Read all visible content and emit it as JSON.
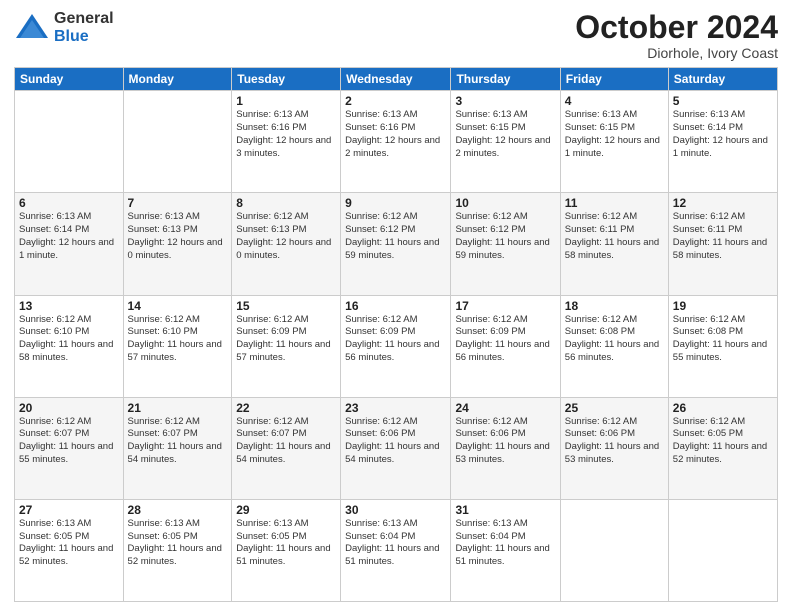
{
  "logo": {
    "general": "General",
    "blue": "Blue"
  },
  "header": {
    "month": "October 2024",
    "location": "Diorhole, Ivory Coast"
  },
  "days_of_week": [
    "Sunday",
    "Monday",
    "Tuesday",
    "Wednesday",
    "Thursday",
    "Friday",
    "Saturday"
  ],
  "weeks": [
    [
      {
        "day": "",
        "info": ""
      },
      {
        "day": "",
        "info": ""
      },
      {
        "day": "1",
        "info": "Sunrise: 6:13 AM\nSunset: 6:16 PM\nDaylight: 12 hours and 3 minutes."
      },
      {
        "day": "2",
        "info": "Sunrise: 6:13 AM\nSunset: 6:16 PM\nDaylight: 12 hours and 2 minutes."
      },
      {
        "day": "3",
        "info": "Sunrise: 6:13 AM\nSunset: 6:15 PM\nDaylight: 12 hours and 2 minutes."
      },
      {
        "day": "4",
        "info": "Sunrise: 6:13 AM\nSunset: 6:15 PM\nDaylight: 12 hours and 1 minute."
      },
      {
        "day": "5",
        "info": "Sunrise: 6:13 AM\nSunset: 6:14 PM\nDaylight: 12 hours and 1 minute."
      }
    ],
    [
      {
        "day": "6",
        "info": "Sunrise: 6:13 AM\nSunset: 6:14 PM\nDaylight: 12 hours and 1 minute."
      },
      {
        "day": "7",
        "info": "Sunrise: 6:13 AM\nSunset: 6:13 PM\nDaylight: 12 hours and 0 minutes."
      },
      {
        "day": "8",
        "info": "Sunrise: 6:12 AM\nSunset: 6:13 PM\nDaylight: 12 hours and 0 minutes."
      },
      {
        "day": "9",
        "info": "Sunrise: 6:12 AM\nSunset: 6:12 PM\nDaylight: 11 hours and 59 minutes."
      },
      {
        "day": "10",
        "info": "Sunrise: 6:12 AM\nSunset: 6:12 PM\nDaylight: 11 hours and 59 minutes."
      },
      {
        "day": "11",
        "info": "Sunrise: 6:12 AM\nSunset: 6:11 PM\nDaylight: 11 hours and 58 minutes."
      },
      {
        "day": "12",
        "info": "Sunrise: 6:12 AM\nSunset: 6:11 PM\nDaylight: 11 hours and 58 minutes."
      }
    ],
    [
      {
        "day": "13",
        "info": "Sunrise: 6:12 AM\nSunset: 6:10 PM\nDaylight: 11 hours and 58 minutes."
      },
      {
        "day": "14",
        "info": "Sunrise: 6:12 AM\nSunset: 6:10 PM\nDaylight: 11 hours and 57 minutes."
      },
      {
        "day": "15",
        "info": "Sunrise: 6:12 AM\nSunset: 6:09 PM\nDaylight: 11 hours and 57 minutes."
      },
      {
        "day": "16",
        "info": "Sunrise: 6:12 AM\nSunset: 6:09 PM\nDaylight: 11 hours and 56 minutes."
      },
      {
        "day": "17",
        "info": "Sunrise: 6:12 AM\nSunset: 6:09 PM\nDaylight: 11 hours and 56 minutes."
      },
      {
        "day": "18",
        "info": "Sunrise: 6:12 AM\nSunset: 6:08 PM\nDaylight: 11 hours and 56 minutes."
      },
      {
        "day": "19",
        "info": "Sunrise: 6:12 AM\nSunset: 6:08 PM\nDaylight: 11 hours and 55 minutes."
      }
    ],
    [
      {
        "day": "20",
        "info": "Sunrise: 6:12 AM\nSunset: 6:07 PM\nDaylight: 11 hours and 55 minutes."
      },
      {
        "day": "21",
        "info": "Sunrise: 6:12 AM\nSunset: 6:07 PM\nDaylight: 11 hours and 54 minutes."
      },
      {
        "day": "22",
        "info": "Sunrise: 6:12 AM\nSunset: 6:07 PM\nDaylight: 11 hours and 54 minutes."
      },
      {
        "day": "23",
        "info": "Sunrise: 6:12 AM\nSunset: 6:06 PM\nDaylight: 11 hours and 54 minutes."
      },
      {
        "day": "24",
        "info": "Sunrise: 6:12 AM\nSunset: 6:06 PM\nDaylight: 11 hours and 53 minutes."
      },
      {
        "day": "25",
        "info": "Sunrise: 6:12 AM\nSunset: 6:06 PM\nDaylight: 11 hours and 53 minutes."
      },
      {
        "day": "26",
        "info": "Sunrise: 6:12 AM\nSunset: 6:05 PM\nDaylight: 11 hours and 52 minutes."
      }
    ],
    [
      {
        "day": "27",
        "info": "Sunrise: 6:13 AM\nSunset: 6:05 PM\nDaylight: 11 hours and 52 minutes."
      },
      {
        "day": "28",
        "info": "Sunrise: 6:13 AM\nSunset: 6:05 PM\nDaylight: 11 hours and 52 minutes."
      },
      {
        "day": "29",
        "info": "Sunrise: 6:13 AM\nSunset: 6:05 PM\nDaylight: 11 hours and 51 minutes."
      },
      {
        "day": "30",
        "info": "Sunrise: 6:13 AM\nSunset: 6:04 PM\nDaylight: 11 hours and 51 minutes."
      },
      {
        "day": "31",
        "info": "Sunrise: 6:13 AM\nSunset: 6:04 PM\nDaylight: 11 hours and 51 minutes."
      },
      {
        "day": "",
        "info": ""
      },
      {
        "day": "",
        "info": ""
      }
    ]
  ]
}
